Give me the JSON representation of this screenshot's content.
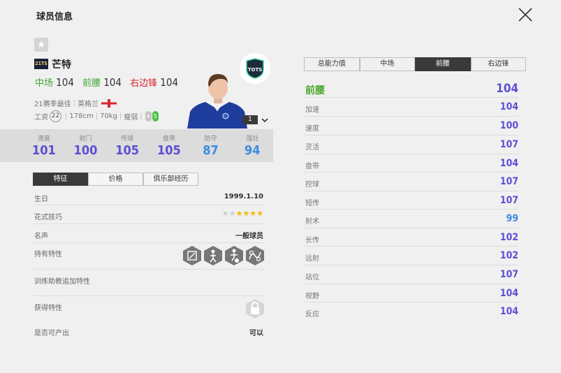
{
  "window": {
    "title": "球员信息"
  },
  "player": {
    "season_badge": "21TS",
    "name": "芒特",
    "positions": [
      {
        "name": "中场",
        "value": "104",
        "color": "#3fa535"
      },
      {
        "name": "前腰",
        "value": "104",
        "color": "#3fa535"
      },
      {
        "name": "右边锋",
        "value": "104",
        "color": "#d8262c"
      }
    ],
    "season": "21赛季最佳",
    "nation": "英格兰",
    "wage_label": "工资",
    "wage": "22",
    "height": "178cm",
    "weight": "70kg",
    "body": "瘦弱",
    "weak_foot": "4",
    "strong_foot": "5",
    "club_badge": "TOTS",
    "level": "1"
  },
  "stats": [
    {
      "label": "速度",
      "value": "101",
      "color": "#5b4fd4"
    },
    {
      "label": "射门",
      "value": "100",
      "color": "#5b4fd4"
    },
    {
      "label": "传球",
      "value": "105",
      "color": "#5b4fd4"
    },
    {
      "label": "盘带",
      "value": "105",
      "color": "#5b4fd4"
    },
    {
      "label": "防守",
      "value": "87",
      "color": "#3a8be0"
    },
    {
      "label": "强壮",
      "value": "94",
      "color": "#3a8be0"
    }
  ],
  "tabs": [
    "特征",
    "价格",
    "俱乐部经历"
  ],
  "features": {
    "birthday_label": "生日",
    "birthday": "1999.1.10",
    "skill_label": "花式技巧",
    "skill_stars": 4,
    "skill_max": 6,
    "reputation_label": "名声",
    "reputation": "一般球员",
    "traits_label": "持有特性",
    "trainer_traits_label": "训练助教追加特性",
    "acquired_traits_label": "获得特性",
    "producible_label": "是否可产出",
    "producible": "可以"
  },
  "right_tabs": [
    "总能力值",
    "中场",
    "前腰",
    "右边锋"
  ],
  "attributes": [
    {
      "name": "前腰",
      "value": "104"
    },
    {
      "name": "加速",
      "value": "104"
    },
    {
      "name": "速度",
      "value": "100"
    },
    {
      "name": "灵活",
      "value": "107"
    },
    {
      "name": "盘带",
      "value": "104"
    },
    {
      "name": "控球",
      "value": "107"
    },
    {
      "name": "短传",
      "value": "107"
    },
    {
      "name": "射术",
      "value": "99"
    },
    {
      "name": "长传",
      "value": "102"
    },
    {
      "name": "远射",
      "value": "102"
    },
    {
      "name": "站位",
      "value": "107"
    },
    {
      "name": "视野",
      "value": "104"
    },
    {
      "name": "反应",
      "value": "104"
    }
  ]
}
